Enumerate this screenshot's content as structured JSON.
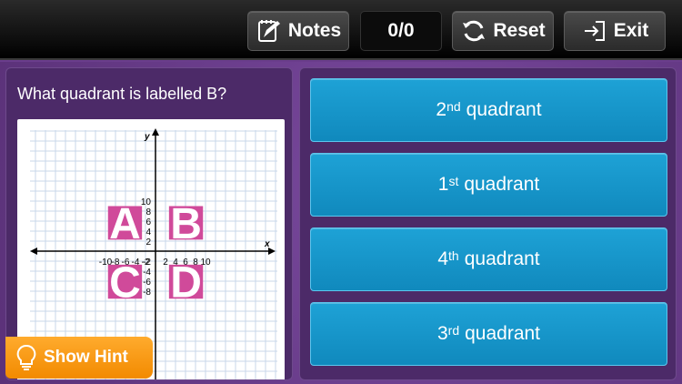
{
  "toolbar": {
    "notes_label": "Notes",
    "score": "0/0",
    "reset_label": "Reset",
    "exit_label": "Exit"
  },
  "question": {
    "text": "What quadrant is labelled B?"
  },
  "graph": {
    "x_axis_label": "x",
    "y_axis_label": "y",
    "x_ticks": [
      "-10",
      "-8",
      "-6",
      "-4",
      "-2",
      "2",
      "4",
      "6",
      "8",
      "10"
    ],
    "y_ticks": [
      "10",
      "8",
      "6",
      "4",
      "2",
      "-2",
      "-4",
      "-6",
      "-8"
    ],
    "quadrant_labels": [
      "A",
      "B",
      "C",
      "D"
    ],
    "quadrant_color": "#d04a9a"
  },
  "answers": [
    {
      "ordinal": "2",
      "suffix": "nd",
      "word": "quadrant"
    },
    {
      "ordinal": "1",
      "suffix": "st",
      "word": "quadrant"
    },
    {
      "ordinal": "4",
      "suffix": "th",
      "word": "quadrant"
    },
    {
      "ordinal": "3",
      "suffix": "rd",
      "word": "quadrant"
    }
  ],
  "hint": {
    "label": "Show Hint"
  },
  "colors": {
    "answer_blue": "#1a98cc",
    "hint_orange": "#f5950f",
    "panel_purple": "#4c2a68"
  }
}
